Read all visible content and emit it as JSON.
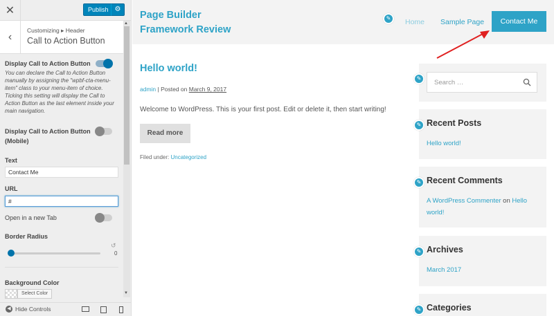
{
  "customizer": {
    "close_icon": "close-icon",
    "publish_label": "Publish",
    "breadcrumb": "Customizing ▸ Header",
    "section_title": "Call to Action Button",
    "cta_toggle_label": "Display Call to Action Button",
    "cta_toggle_on": true,
    "cta_description": "You can declare the Call to Action Button manually by assigning the \"wpbf-cta-menu-item\" class to your menu-item of choice. Ticking this setting will display the Call to Action Button as the last element inside your main navigation.",
    "mobile_toggle_label_1": "Display Call to Action Button",
    "mobile_toggle_label_2": "(Mobile)",
    "mobile_toggle_on": false,
    "text_label": "Text",
    "text_value": "Contact Me",
    "url_label": "URL",
    "url_value": "#",
    "new_tab_label": "Open in a new Tab",
    "new_tab_on": false,
    "border_radius_label": "Border Radius",
    "border_radius_value": "0",
    "bg_color_label": "Background Color",
    "select_color_label": "Select Color",
    "hide_controls_label": "Hide Controls",
    "accent_color": "#0085ba"
  },
  "site": {
    "title_line1": "Page Builder",
    "title_line2": "Framework Review",
    "nav": [
      "Home",
      "Sample Page"
    ],
    "cta_label": "Contact Me",
    "brand_color": "#2ea3c7"
  },
  "post": {
    "title": "Hello world!",
    "author": "admin",
    "posted_on": " | Posted on ",
    "date": "March 9, 2017",
    "body": "Welcome to WordPress. This is your first post. Edit or delete it, then start writing!",
    "read_more": "Read more",
    "filed_under": "Filed under: ",
    "category": "Uncategorized"
  },
  "sidebar": {
    "search_placeholder": "Search …",
    "recent_posts_title": "Recent Posts",
    "recent_posts": [
      "Hello world!"
    ],
    "recent_comments_title": "Recent Comments",
    "comment_author": "A WordPress Commenter",
    "comment_on": " on ",
    "comment_post": "Hello world!",
    "archives_title": "Archives",
    "archives": [
      "March 2017"
    ],
    "categories_title": "Categories"
  }
}
